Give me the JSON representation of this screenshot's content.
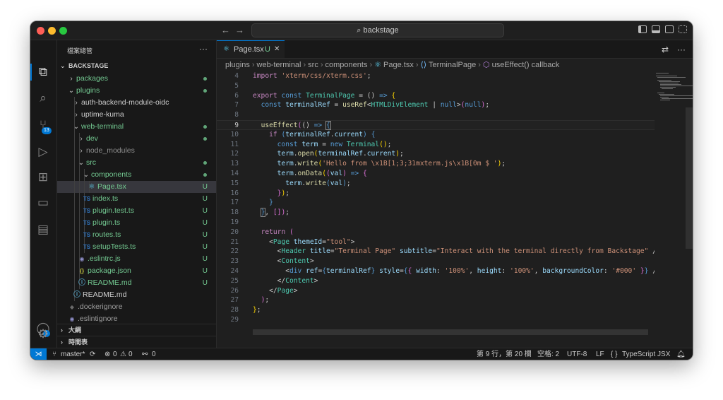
{
  "titlebar": {
    "search_text": "backstage",
    "search_icon": "search-icon"
  },
  "activity": {
    "scm_badge": "13",
    "accounts_badge": "1"
  },
  "sidebar": {
    "title": "檔案總管",
    "more": "···",
    "root": "BACKSTAGE",
    "items": [
      {
        "label": "packages",
        "chev": "›",
        "status": "dot",
        "depth": 1
      },
      {
        "label": "plugins",
        "chev": "⌄",
        "status": "dot",
        "depth": 1
      },
      {
        "label": "auth-backend-module-oidc",
        "chev": "›",
        "status": "",
        "depth": 2
      },
      {
        "label": "uptime-kuma",
        "chev": "›",
        "status": "",
        "depth": 2
      },
      {
        "label": "web-terminal",
        "chev": "⌄",
        "status": "dot",
        "depth": 2
      },
      {
        "label": "dev",
        "chev": "›",
        "status": "dot",
        "depth": 3
      },
      {
        "label": "node_modules",
        "chev": "›",
        "status": "",
        "depth": 3
      },
      {
        "label": "src",
        "chev": "⌄",
        "status": "dot",
        "depth": 3
      },
      {
        "label": "components",
        "chev": "⌄",
        "status": "dot",
        "depth": 4
      },
      {
        "label": "Page.tsx",
        "icon": "⚛",
        "status": "U",
        "depth": 5
      },
      {
        "label": "index.ts",
        "icon": "TS",
        "status": "U",
        "depth": 4
      },
      {
        "label": "plugin.test.ts",
        "icon": "TS",
        "status": "U",
        "depth": 4
      },
      {
        "label": "plugin.ts",
        "icon": "TS",
        "status": "U",
        "depth": 4
      },
      {
        "label": "routes.ts",
        "icon": "TS",
        "status": "U",
        "depth": 4
      },
      {
        "label": "setupTests.ts",
        "icon": "TS",
        "status": "U",
        "depth": 4
      },
      {
        "label": ".eslintrc.js",
        "icon": "◉",
        "status": "U",
        "depth": 3
      },
      {
        "label": "package.json",
        "icon": "{}",
        "status": "U",
        "depth": 3
      },
      {
        "label": "README.md",
        "icon": "ⓘ",
        "status": "U",
        "depth": 3
      },
      {
        "label": "README.md",
        "icon": "ⓘ",
        "status": "",
        "depth": 2
      },
      {
        "label": ".dockerignore",
        "icon": "◆",
        "status": "",
        "depth": 1
      },
      {
        "label": ".eslintignore",
        "icon": "◉",
        "status": "",
        "depth": 1
      }
    ],
    "outline": "大綱",
    "timeline": "時間表"
  },
  "editor": {
    "tab_label": "Page.tsx",
    "tab_status": "U",
    "tab_close": "✕",
    "breadcrumbs": [
      "plugins",
      "web-terminal",
      "src",
      "components",
      "Page.tsx",
      "TerminalPage",
      "useEffect() callback"
    ]
  },
  "code_lines": [
    {
      "n": "4",
      "html": "<span class='kc'>import</span> <span class='s'>'xterm/css/xterm.css'</span>;"
    },
    {
      "n": "5",
      "html": ""
    },
    {
      "n": "6",
      "html": "<span class='kc'>export</span> <span class='k'>const</span> <span class='t'>TerminalPage</span> = () <span class='k'>=&gt;</span> <span class='p'>{</span>"
    },
    {
      "n": "7",
      "html": "  <span class='k'>const</span> <span class='v'>terminalRef</span> = <span class='f'>useRef</span>&lt;<span class='t'>HTMLDivElement</span> | <span class='k'>null</span>&gt;<span class='q'>(</span><span class='k'>null</span><span class='q'>)</span>;"
    },
    {
      "n": "8",
      "html": ""
    },
    {
      "n": "9",
      "html": "  <span class='f'>useEffect</span><span class='q'>(</span>() <span class='k'>=&gt;</span> <span class='k' style='outline:1px solid #888'>{</span>",
      "cur": true
    },
    {
      "n": "10",
      "html": "    <span class='kc'>if</span> <span class='k'>(</span><span class='v'>terminalRef</span>.<span class='v'>current</span><span class='k'>)</span> <span class='k'>{</span>"
    },
    {
      "n": "11",
      "html": "      <span class='k'>const</span> <span class='v'>term</span> = <span class='k'>new</span> <span class='t'>Terminal</span><span class='p'>()</span>;"
    },
    {
      "n": "12",
      "html": "      <span class='v'>term</span>.<span class='f'>open</span><span class='p'>(</span><span class='v'>terminalRef</span>.<span class='v'>current</span><span class='p'>)</span>;"
    },
    {
      "n": "13",
      "html": "      <span class='v'>term</span>.<span class='f'>write</span><span class='p'>(</span><span class='s'>'Hello from \\x1B[1;3;31mxterm.js\\x1B[0m $ '</span><span class='p'>)</span>;"
    },
    {
      "n": "14",
      "html": "      <span class='v'>term</span>.<span class='f'>onData</span><span class='p'>(</span><span class='q'>(</span><span class='v'>val</span><span class='q'>)</span> <span class='k'>=&gt;</span> <span class='q'>{</span>"
    },
    {
      "n": "15",
      "html": "        <span class='v'>term</span>.<span class='f'>write</span><span class='k'>(</span><span class='v'>val</span><span class='k'>)</span>;"
    },
    {
      "n": "16",
      "html": "      <span class='q'>}</span><span class='p'>)</span>;"
    },
    {
      "n": "17",
      "html": "    <span class='k'>}</span>"
    },
    {
      "n": "18",
      "html": "  <span class='k' style='outline:1px solid #888'>}</span>, <span class='q'>[]</span><span class='q'>)</span>;"
    },
    {
      "n": "19",
      "html": ""
    },
    {
      "n": "20",
      "html": "  <span class='kc'>return</span> <span class='q'>(</span>"
    },
    {
      "n": "21",
      "html": "    <span class='w'>&lt;</span><span class='t'>Page</span> <span class='a'>themeId</span>=<span class='s'>\"tool\"</span><span class='w'>&gt;</span>"
    },
    {
      "n": "22",
      "html": "      <span class='w'>&lt;</span><span class='t'>Header</span> <span class='a'>title</span>=<span class='s'>\"Terminal Page\"</span> <span class='a'>subtitle</span>=<span class='s'>\"Interact with the terminal directly from Backstage\"</span> <span class='w'>/&gt;</span>"
    },
    {
      "n": "23",
      "html": "      <span class='w'>&lt;</span><span class='t'>Content</span><span class='w'>&gt;</span>"
    },
    {
      "n": "24",
      "html": "        <span class='w'>&lt;</span><span class='tg'>div</span> <span class='a'>ref</span>=<span class='k'>{</span><span class='v'>terminalRef</span><span class='k'>}</span> <span class='a'>style</span>=<span class='k'>{</span><span class='q'>{</span> <span class='v'>width</span>: <span class='s'>'100%'</span>, <span class='v'>height</span>: <span class='s'>'100%'</span>, <span class='v'>backgroundColor</span>: <span class='s'>'#000'</span> <span class='q'>}</span><span class='k'>}</span> <span class='w'>/&gt;</span>"
    },
    {
      "n": "25",
      "html": "      <span class='w'>&lt;/</span><span class='t'>Content</span><span class='w'>&gt;</span>"
    },
    {
      "n": "26",
      "html": "    <span class='w'>&lt;/</span><span class='t'>Page</span><span class='w'>&gt;</span>"
    },
    {
      "n": "27",
      "html": "  <span class='q'>)</span>;"
    },
    {
      "n": "28",
      "html": "<span class='p'>}</span>;"
    },
    {
      "n": "29",
      "html": ""
    }
  ],
  "statusbar": {
    "branch": "master*",
    "errors": "0",
    "warnings": "0",
    "ports": "0",
    "position": "第 9 行，第 20 欄",
    "spaces": "空格: 2",
    "encoding": "UTF-8",
    "eol": "LF",
    "language": "TypeScript JSX"
  },
  "colors": {
    "accent": "#0078d4",
    "untracked": "#73c991",
    "ts_icon": "#3178c6",
    "react_icon": "#61dafb"
  }
}
